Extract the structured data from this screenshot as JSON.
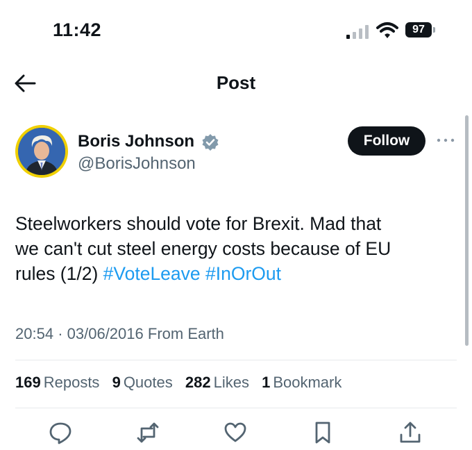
{
  "status_bar": {
    "time": "11:42",
    "battery": "97"
  },
  "nav": {
    "title": "Post"
  },
  "author": {
    "name": "Boris Johnson",
    "handle": "@BorisJohnson"
  },
  "follow_label": "Follow",
  "post": {
    "text_line1": "Steelworkers should vote for Brexit. Mad that",
    "text_line2": "we can't cut steel energy costs because of EU",
    "text_line3_prefix": "rules (1/2) ",
    "hashtags": [
      "#VoteLeave",
      "#InOrOut"
    ],
    "time": "20:54",
    "date": "03/06/2016",
    "source": "From Earth"
  },
  "stats": [
    {
      "count": "169",
      "label": "Reposts"
    },
    {
      "count": "9",
      "label": "Quotes"
    },
    {
      "count": "282",
      "label": "Likes"
    },
    {
      "count": "1",
      "label": "Bookmark"
    }
  ],
  "actions": [
    "reply-icon",
    "repost-icon",
    "like-icon",
    "bookmark-icon",
    "share-icon"
  ],
  "colors": {
    "accent": "#1d9bf0",
    "text": "#0f1419",
    "secondary": "#536471",
    "verified": "#829aab",
    "avatar_ring": "#f0d000"
  }
}
